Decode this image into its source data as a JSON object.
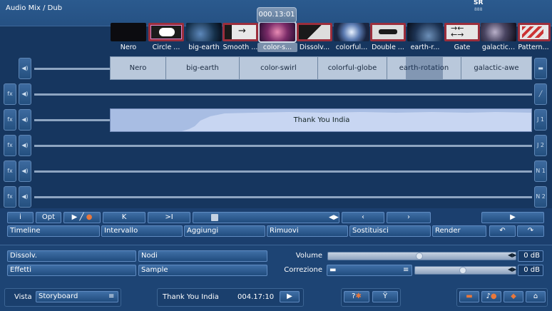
{
  "window": {
    "title": "Audio Mix / Dub",
    "logo_main": "SR",
    "logo_sub": "888"
  },
  "timecode": "000.13:01",
  "thumbnails": [
    {
      "label": "Nero"
    },
    {
      "label": "Circle ..."
    },
    {
      "label": "big-earth"
    },
    {
      "label": "Smooth ..."
    },
    {
      "label": "color-s...",
      "selected": true
    },
    {
      "label": "Dissolv..."
    },
    {
      "label": "colorful..."
    },
    {
      "label": "Double ..."
    },
    {
      "label": "earth-r..."
    },
    {
      "label": "Gate"
    },
    {
      "label": "galactic..."
    },
    {
      "label": "Pattern..."
    }
  ],
  "scenes": [
    "Nero",
    "big-earth",
    "color-swirl",
    "colorful-globe",
    "earth-rotation",
    "galactic-awe"
  ],
  "audio_track": {
    "title": "Thank You India"
  },
  "track_labels": {
    "fx": "fx",
    "j1": "J 1",
    "j2": "J 2",
    "n1": "N 1",
    "n2": "N 2"
  },
  "toolbar": {
    "info": "i",
    "opt": "Opt",
    "timeline": "Timeline",
    "intervallo": "Intervallo",
    "aggiungi": "Aggiungi",
    "rimuovi": "Rimuovi",
    "sostituisci": "Sostituisci",
    "render": "Render"
  },
  "bottom": {
    "dissolv": "Dissolv.",
    "nodi": "Nodi",
    "effetti": "Effetti",
    "sample": "Sample",
    "volume_label": "Volume",
    "volume_db": "0 dB",
    "correzione_label": "Correzione",
    "correzione_db": "0 dB",
    "vista_label": "Vista",
    "vista_value": "Storyboard",
    "project_title": "Thank You India",
    "project_duration": "004.17:10"
  },
  "colors": {
    "background": "#1b3f6e",
    "accent": "#e8783c"
  }
}
